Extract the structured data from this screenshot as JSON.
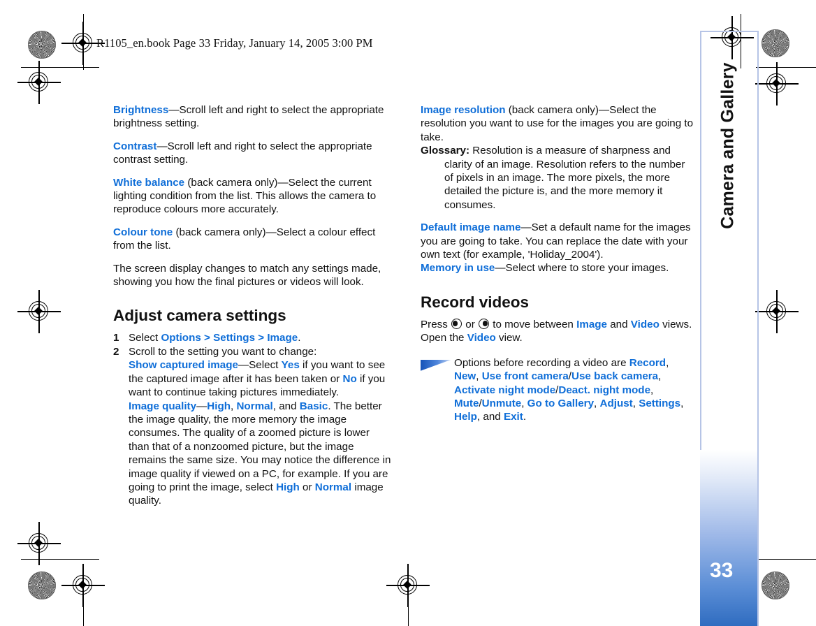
{
  "header": {
    "book_line": "R1105_en.book  Page 33  Friday, January 14, 2005  3:00 PM"
  },
  "sidebar": {
    "chapter_title": "Camera and Gallery",
    "page_number": "33",
    "accent_color": "#2f6cc0"
  },
  "colors": {
    "link_blue": "#0f6ed8",
    "frame_blue": "#b6c4e6",
    "text_black": "#111111"
  },
  "left_column": {
    "paragraphs": [
      {
        "id": "brightness",
        "term": "Brightness",
        "rest": "—Scroll left and right to select the appropriate brightness setting."
      },
      {
        "id": "contrast",
        "term": "Contrast",
        "rest": "—Scroll left and right to select the appropriate contrast setting."
      },
      {
        "id": "white-balance",
        "term": "White balance",
        "rest": " (back camera only)—Select the current lighting condition from the list. This allows the camera to reproduce colours more accurately."
      },
      {
        "id": "colour-tone",
        "term": "Colour tone",
        "rest": " (back camera only)—Select a colour effect from the list."
      }
    ],
    "screen_display_note": "The screen display changes to match any settings made, showing you how the final pictures or videos will look.",
    "heading": "Adjust camera settings",
    "steps": [
      {
        "num": "1",
        "pre": "Select ",
        "link": "Options > Settings > Image",
        "post": "."
      },
      {
        "num": "2",
        "pre": "Scroll to the setting you want to change:",
        "link": "",
        "post": ""
      }
    ],
    "show_captured": {
      "term": "Show captured image",
      "seg1": "—Select ",
      "yes": "Yes",
      "seg2": " if you want to see the captured image after it has been taken or ",
      "no": "No",
      "seg3": " if you want to continue taking pictures immediately."
    },
    "image_quality": {
      "term": "Image quality",
      "dash": "—",
      "high": "High",
      "sep1": ", ",
      "normal": "Normal",
      "sep2": ", and ",
      "basic": "Basic",
      "body": ". The better the image quality, the more memory the image consumes. The quality of a zoomed picture is lower than that of a nonzoomed picture, but the image remains the same size. You may notice the difference in image quality if viewed on a PC, for example. If you are going to print the image, select ",
      "high2": "High",
      "or": " or ",
      "normal2": "Normal",
      "tail": " image quality."
    }
  },
  "right_column": {
    "image_resolution": {
      "term": "Image resolution",
      "rest": " (back camera only)—Select the resolution you want to use for the images you are going to take."
    },
    "glossary": {
      "label": "Glossary:",
      "text": " Resolution is a measure of sharpness and clarity of an image. Resolution refers to the number of pixels in an image. The more pixels, the more detailed the picture is, and the more memory it consumes."
    },
    "default_image_name": {
      "term": "Default image name",
      "rest": "—Set a default name for the images you are going to take. You can replace the date with your own text (for example, 'Holiday_2004')."
    },
    "memory_in_use": {
      "term": "Memory in use",
      "rest": "—Select where to store your images."
    },
    "heading": "Record videos",
    "press_line": {
      "pre": "Press ",
      "mid": " or ",
      "post": " to move between ",
      "image": "Image",
      "and": " and ",
      "video": "Video",
      "views": " views.",
      "open_pre": "Open the ",
      "open_video": "Video",
      "open_post": " view."
    },
    "tip": {
      "lead": "Options before recording a video are ",
      "options": [
        "Record",
        "New",
        "Use front camera",
        "Use back camera",
        "Activate night mode",
        "Deact. night mode",
        "Mute",
        "Unmute",
        "Go to Gallery",
        "Adjust",
        "Settings",
        "Help",
        "Exit"
      ],
      "and_word": "and",
      "period": "."
    },
    "icons": {
      "joystick_left": "joystick-scroll-left-icon",
      "joystick_right": "joystick-scroll-right-icon",
      "tip_marker": "tip-triangle-icon"
    }
  },
  "print_marks": {
    "star_targets": 4,
    "crosshair_targets": 6,
    "description": "registration-and-crop-marks"
  }
}
